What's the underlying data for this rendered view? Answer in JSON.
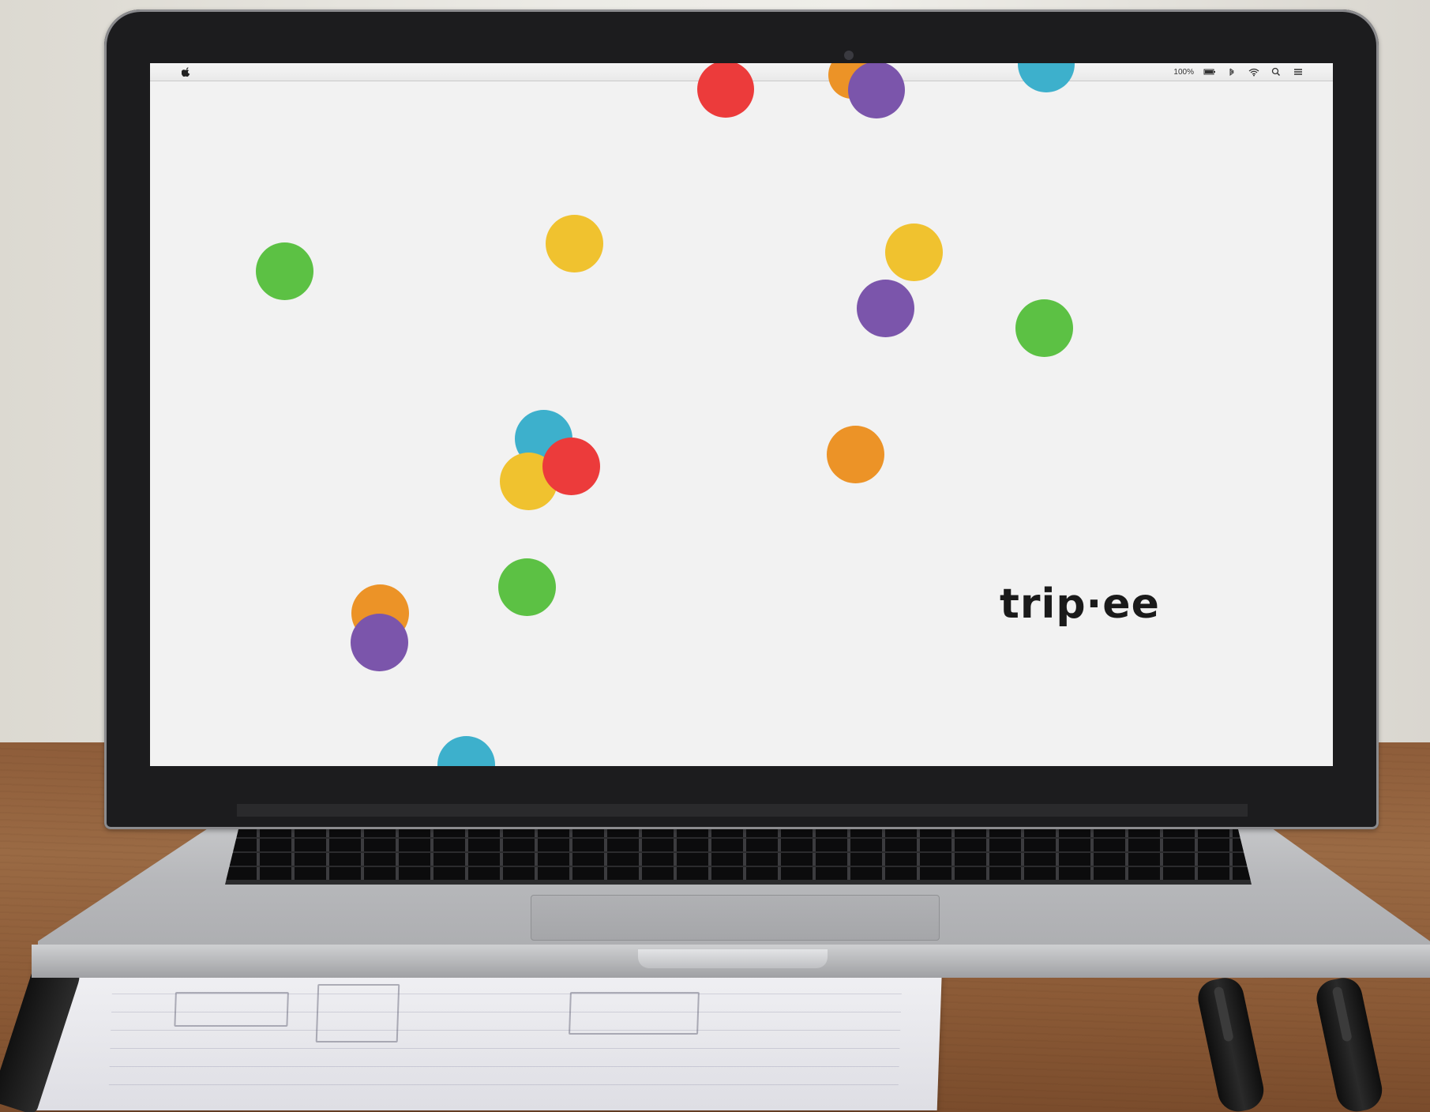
{
  "desktop": {
    "menubar": {
      "apple_icon": "apple-icon",
      "status": {
        "battery_percent": "100%",
        "icons": [
          "battery-icon",
          "bluetooth-icon",
          "wifi-icon",
          "search-icon",
          "list-icon"
        ]
      }
    },
    "screen_content": {
      "logo_text": "trip·ee",
      "dot_colors": {
        "red": "#ec3b3b",
        "orange": "#ec9327",
        "purple": "#7b55ab",
        "teal": "#3db0cc",
        "yellow": "#f0c22f",
        "green": "#5cc144"
      }
    }
  }
}
